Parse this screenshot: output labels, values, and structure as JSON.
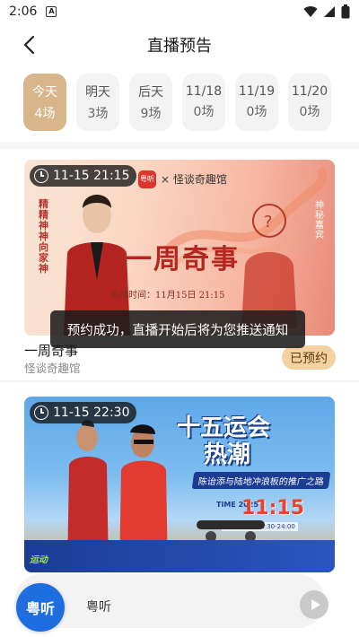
{
  "status": {
    "time": "2:06",
    "notif_letter": "A"
  },
  "nav": {
    "title": "直播预告"
  },
  "days": [
    {
      "day": "今天",
      "count": "4场",
      "active": true
    },
    {
      "day": "明天",
      "count": "3场"
    },
    {
      "day": "后天",
      "count": "9场"
    },
    {
      "day": "11/18",
      "count": "0场"
    },
    {
      "day": "11/19",
      "count": "0场"
    },
    {
      "day": "11/20",
      "count": "0场"
    }
  ],
  "card1": {
    "time": "11-15 21:15",
    "title": "一周奇事",
    "subtitle": "怪谈奇趣馆",
    "reserved_label": "已预约",
    "poster": {
      "logo_text": "粤听",
      "brand": "× 怪谈奇趣馆",
      "vertical_left": "精精神神向家神",
      "vertical_right": "神秘嘉宾",
      "big_title": "一周奇事",
      "date_line": "直播时间：11月15日 21:15"
    }
  },
  "toast": "预约成功，直播开始后将为您推送通知",
  "card2": {
    "time": "11-15 22:30",
    "poster": {
      "title_line1": "十五运会",
      "title_line2": "热潮",
      "ribbon": "陈诒添与陆地冲浪板的推广之路",
      "time_label": "TIME 2025",
      "time_value": "11:15",
      "address": "ADDRESS 22:30-24:00",
      "logo": "运动"
    }
  },
  "player": {
    "logo": "粤听",
    "name": "粤听"
  },
  "colors": {
    "accent": "#d8b58a",
    "reserved_bg": "#f4d19e"
  }
}
